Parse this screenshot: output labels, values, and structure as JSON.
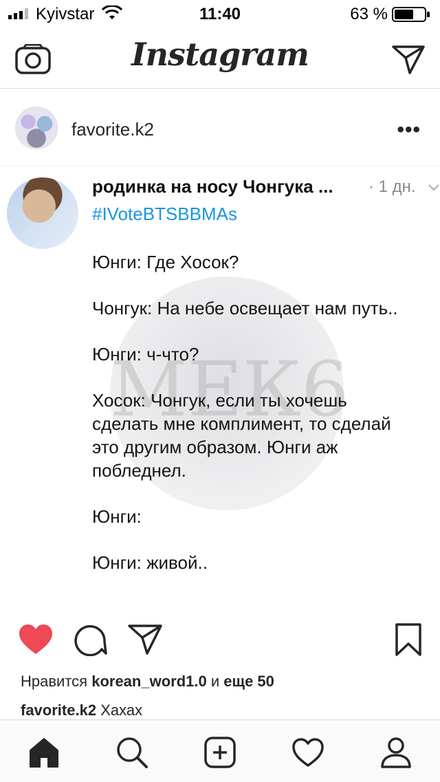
{
  "status_bar": {
    "carrier": "Kyivstar",
    "time": "11:40",
    "battery_percent": "63 %",
    "battery_level": 0.63
  },
  "header": {
    "logo": "Instagram",
    "icons": [
      "camera-icon",
      "direct-send-icon"
    ]
  },
  "post": {
    "username": "favorite.k2",
    "more_label": "•••",
    "image": {
      "tweet_name": "родинка на носу Чонгука",
      "tweet_name_ellipsis": "...",
      "tweet_time": "· 1 дн.",
      "hashtag": "#IVoteBTSBBMAs",
      "lines": [
        "Юнги: Где Хосок?",
        "Чонгук: На небе освещает нам путь..",
        "Юнги: ч-что?",
        "Хосок: Чонгук, если ты хочешь\nсделать мне комплимент, то сделай\nэто другим образом. Юнги аж\nпобледнел.",
        "Юнги:",
        "Юнги: живой.."
      ],
      "watermark": "МЕК6"
    },
    "likes_prefix": "Нравится",
    "likes_user": "korean_word1.0",
    "likes_and": "и",
    "likes_more": "еще 50",
    "caption_user": "favorite.k2",
    "caption_text": "Хахах",
    "liked": true,
    "like_color": "#ed4956"
  },
  "tab_bar": {
    "items": [
      "home-icon",
      "search-icon",
      "add-post-icon",
      "activity-heart-icon",
      "profile-icon"
    ]
  }
}
